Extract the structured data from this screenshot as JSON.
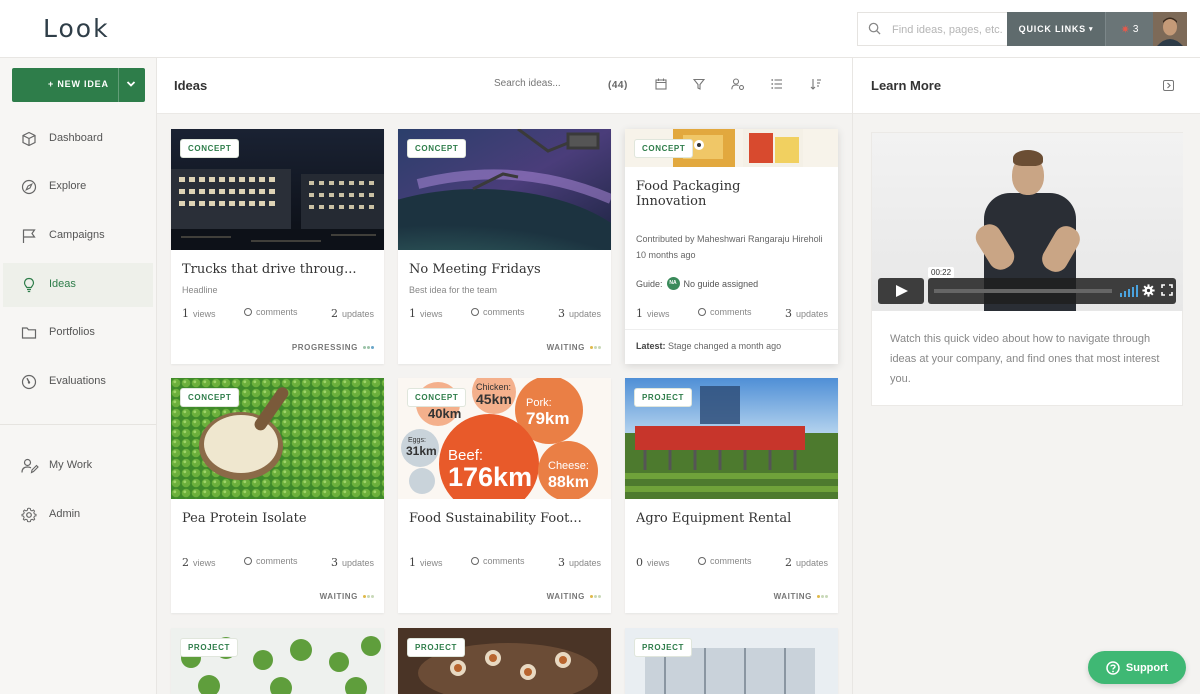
{
  "app": {
    "logo": "Look"
  },
  "header": {
    "search_placeholder": "Find ideas, pages, etc.",
    "quick_links_label": "QUICK LINKS",
    "notifications_count": "3"
  },
  "sidebar": {
    "new_idea_label": "+ NEW IDEA",
    "items": [
      {
        "label": "Dashboard"
      },
      {
        "label": "Explore"
      },
      {
        "label": "Campaigns"
      },
      {
        "label": "Ideas"
      },
      {
        "label": "Portfolios"
      },
      {
        "label": "Evaluations"
      },
      {
        "label": "My Work"
      },
      {
        "label": "Admin"
      }
    ]
  },
  "main": {
    "title": "Ideas",
    "search_placeholder": "Search ideas...",
    "count": "(44)",
    "cards": [
      {
        "badge": "CONCEPT",
        "title": "Trucks that drive throug...",
        "sub": "Headline",
        "views": "1",
        "views_label": "views",
        "comments_label": "comments",
        "updates": "2",
        "updates_label": "updates",
        "status": "PROGRESSING"
      },
      {
        "badge": "CONCEPT",
        "title": "No Meeting Fridays",
        "sub": "Best idea for the team",
        "views": "1",
        "views_label": "views",
        "comments_label": "comments",
        "updates": "3",
        "updates_label": "updates",
        "status": "WAITING"
      },
      {
        "badge": "CONCEPT",
        "title_line1": "Food Packaging",
        "title_line2": "Innovation",
        "contributor": "Contributed by Maheshwari Rangaraju Hireholi",
        "time": "10 months ago",
        "guide_label": "Guide:",
        "guide_initials": "NA",
        "guide_value": "No guide assigned",
        "views": "1",
        "views_label": "views",
        "comments_label": "comments",
        "updates": "3",
        "updates_label": "updates",
        "latest_label": "Latest:",
        "latest_value": "Stage changed a month ago"
      },
      {
        "badge": "CONCEPT",
        "title": "Pea Protein Isolate",
        "views": "2",
        "views_label": "views",
        "comments_label": "comments",
        "updates": "3",
        "updates_label": "updates",
        "status": "WAITING"
      },
      {
        "badge": "CONCEPT",
        "title": "Food Sustainability Foot...",
        "views": "1",
        "views_label": "views",
        "comments_label": "comments",
        "updates": "3",
        "updates_label": "updates",
        "status": "WAITING",
        "image_text": {
          "chicken": "Chicken:",
          "chicken_val": "45km",
          "pork": "Pork:",
          "pork_val": "79km",
          "beef": "Beef:",
          "beef_val": "176km",
          "cheese": "Cheese:",
          "cheese_val": "88km",
          "eggs": "Eggs:",
          "eggs_val": "31km",
          "lamb_val": "40km"
        }
      },
      {
        "badge": "PROJECT",
        "title": "Agro Equipment Rental",
        "views": "0",
        "views_label": "views",
        "comments_label": "comments",
        "updates": "2",
        "updates_label": "updates",
        "status": "WAITING"
      },
      {
        "badge": "PROJECT"
      },
      {
        "badge": "PROJECT"
      },
      {
        "badge": "PROJECT"
      }
    ]
  },
  "learn_more": {
    "title": "Learn More",
    "video_time": "00:22",
    "description": "Watch this quick video about how to navigate through ideas at your company, and find ones that most interest you."
  },
  "support": {
    "label": "Support"
  },
  "colors": {
    "brand_green": "#2e7d4a",
    "support_green": "#3fb874",
    "quick_links_bg": "#5f6b6d"
  }
}
